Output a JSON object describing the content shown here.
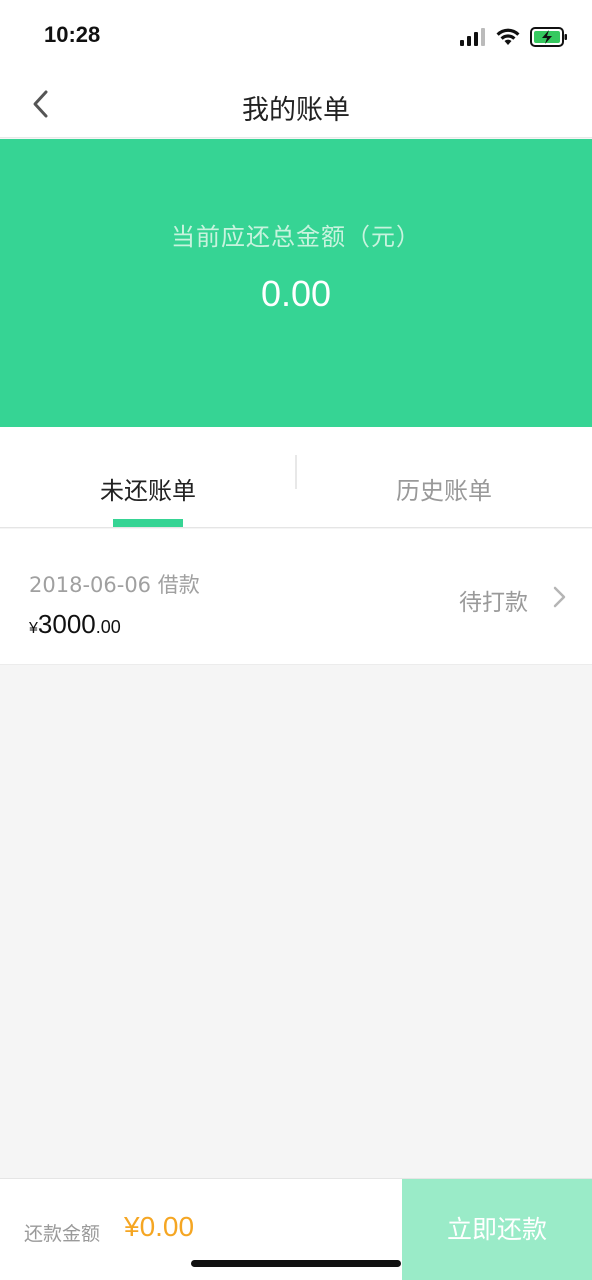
{
  "status_bar": {
    "time": "10:28"
  },
  "nav": {
    "title": "我的账单"
  },
  "summary": {
    "label": "当前应还总金额（元）",
    "amount": "0.00"
  },
  "tabs": [
    {
      "label": "未还账单",
      "active": true
    },
    {
      "label": "历史账单",
      "active": false
    }
  ],
  "bills": [
    {
      "date_label": "2018-06-06 借款",
      "currency": "¥",
      "amount_int": "3000",
      "amount_dec": ".00",
      "status": "待打款"
    }
  ],
  "bottom": {
    "pay_label": "还款金额",
    "pay_amount": "¥0.00",
    "pay_button": "立即还款"
  },
  "colors": {
    "brand_green": "#36d494",
    "button_disabled_green": "#9aebc8",
    "amount_orange": "#f5a623"
  },
  "icons": [
    "signal-icon",
    "wifi-icon",
    "battery-charging-icon",
    "back-chevron-icon",
    "chevron-right-icon"
  ]
}
